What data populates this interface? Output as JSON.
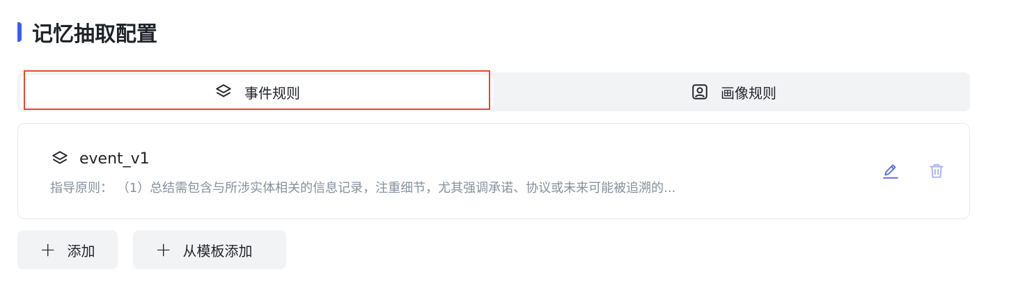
{
  "section": {
    "title": "记忆抽取配置",
    "accent_color": "#3b5bfd"
  },
  "tabs": [
    {
      "label": "事件规则",
      "icon": "layers-icon",
      "active": true
    },
    {
      "label": "画像规则",
      "icon": "user-portrait-icon",
      "active": false
    }
  ],
  "highlight_color": "#e8472a",
  "rule_card": {
    "name": "event_v1",
    "icon": "layers-icon",
    "description": "指导原则：  （1）总结需包含与所涉实体相关的信息记录，注重细节，尤其强调承诺、协议或未来可能被追溯的...",
    "actions": [
      "edit-icon",
      "delete-icon"
    ]
  },
  "buttons": {
    "add": "添加",
    "add_from_template": "从模板添加"
  }
}
